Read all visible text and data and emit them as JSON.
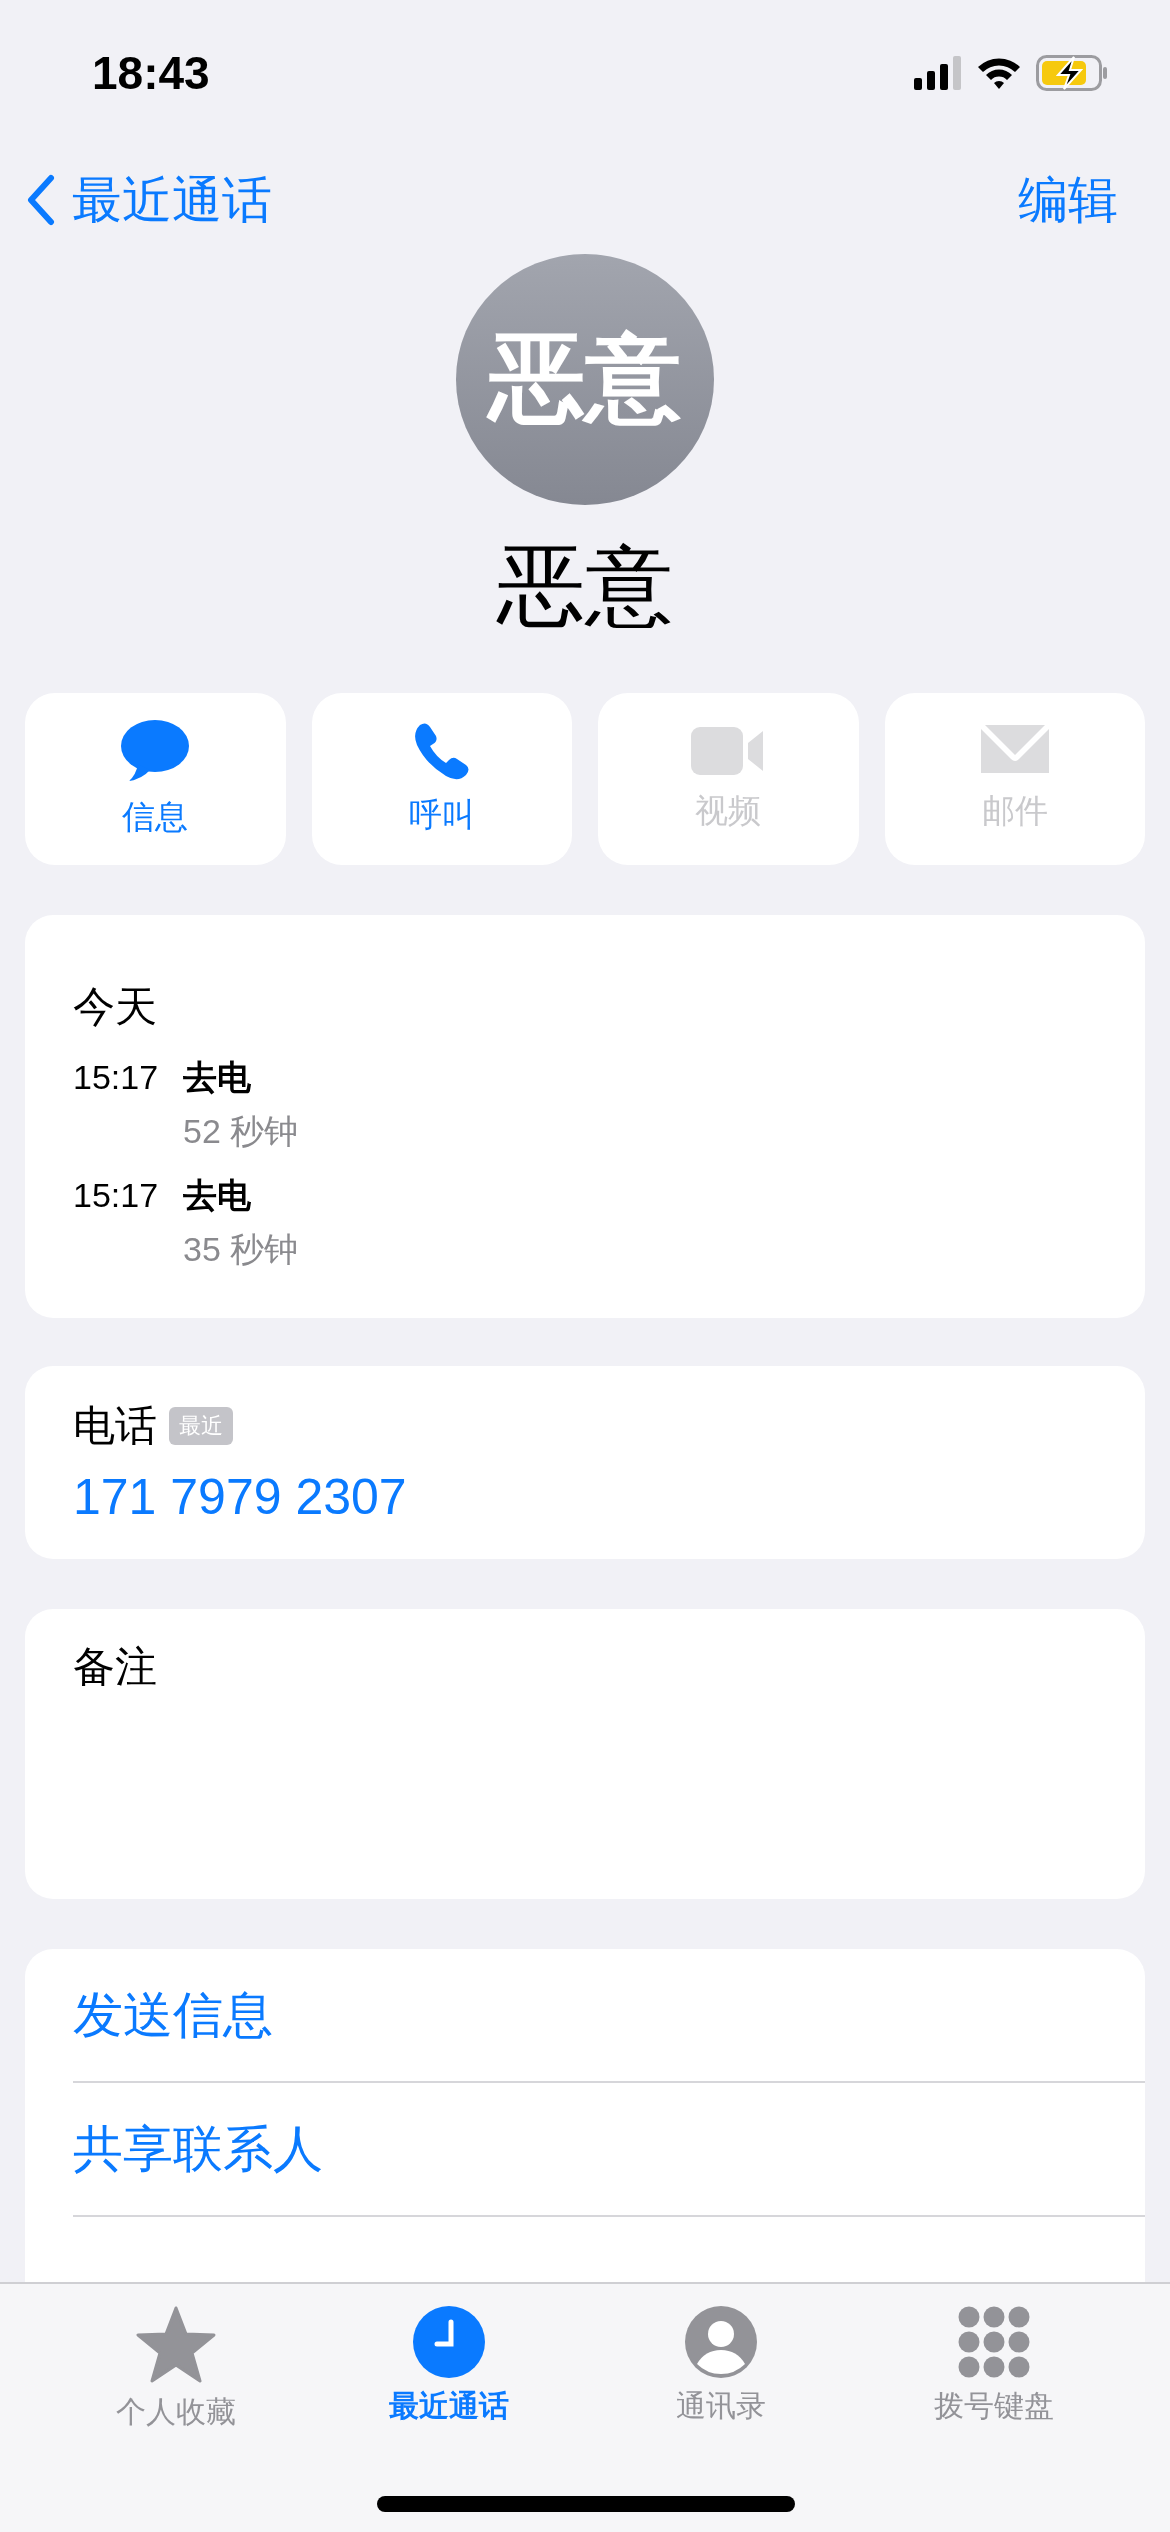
{
  "status_bar": {
    "time": "18:43"
  },
  "nav": {
    "back_label": "最近通话",
    "edit_label": "编辑"
  },
  "contact": {
    "avatar_text": "恶意",
    "name": "恶意"
  },
  "actions": [
    {
      "kind": "message",
      "label": "信息",
      "disabled": false
    },
    {
      "kind": "call",
      "label": "呼叫",
      "disabled": false
    },
    {
      "kind": "video",
      "label": "视频",
      "disabled": true
    },
    {
      "kind": "mail",
      "label": "邮件",
      "disabled": true
    }
  ],
  "recents": {
    "heading": "今天",
    "calls": [
      {
        "time": "15:17",
        "type": "去电",
        "duration": "52 秒钟"
      },
      {
        "time": "15:17",
        "type": "去电",
        "duration": "35 秒钟"
      }
    ]
  },
  "phone": {
    "label": "电话",
    "badge": "最近",
    "number": "171 7979 2307"
  },
  "notes": {
    "label": "备注"
  },
  "action_list": [
    {
      "label": "发送信息"
    },
    {
      "label": "共享联系人"
    }
  ],
  "tab_bar": [
    {
      "kind": "favorites",
      "label": "个人收藏",
      "selected": false
    },
    {
      "kind": "recents",
      "label": "最近通话",
      "selected": true
    },
    {
      "kind": "contacts",
      "label": "通讯录",
      "selected": false
    },
    {
      "kind": "keypad",
      "label": "拨号键盘",
      "selected": false
    }
  ]
}
